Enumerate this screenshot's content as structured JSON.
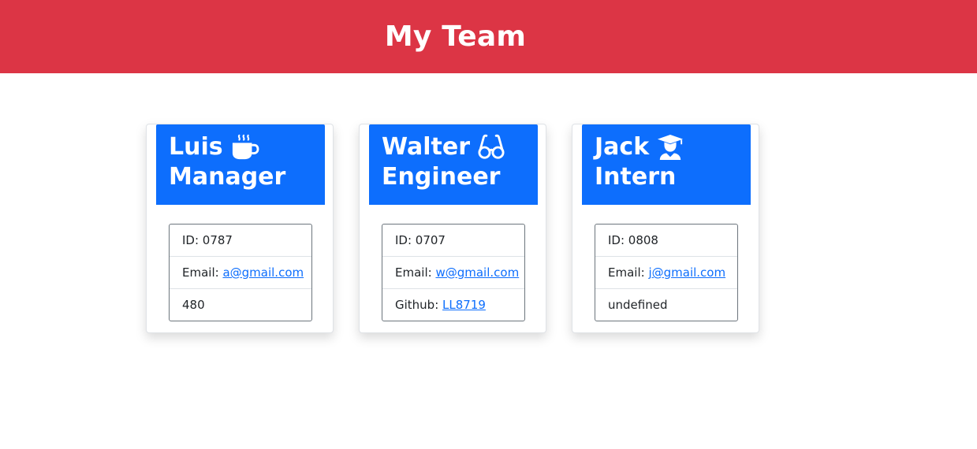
{
  "header": {
    "title": "My Team"
  },
  "colors": {
    "header_bg": "#dc3545",
    "card_head_bg": "#0d6efd",
    "link": "#0d6efd"
  },
  "employees": [
    {
      "name": "Luis",
      "role": "Manager",
      "icon": "coffee-icon",
      "id_label": "ID: ",
      "id": "0787",
      "email_label": "Email: ",
      "email": "a@gmail.com",
      "extra_label": "",
      "extra": "480"
    },
    {
      "name": "Walter",
      "role": "Engineer",
      "icon": "glasses-icon",
      "id_label": "ID: ",
      "id": "0707",
      "email_label": "Email: ",
      "email": "w@gmail.com",
      "extra_label": "Github: ",
      "extra": "LL8719"
    },
    {
      "name": "Jack",
      "role": "Intern",
      "icon": "graduate-icon",
      "id_label": "ID: ",
      "id": "0808",
      "email_label": "Email: ",
      "email": "j@gmail.com",
      "extra_label": "",
      "extra": "undefined"
    }
  ]
}
